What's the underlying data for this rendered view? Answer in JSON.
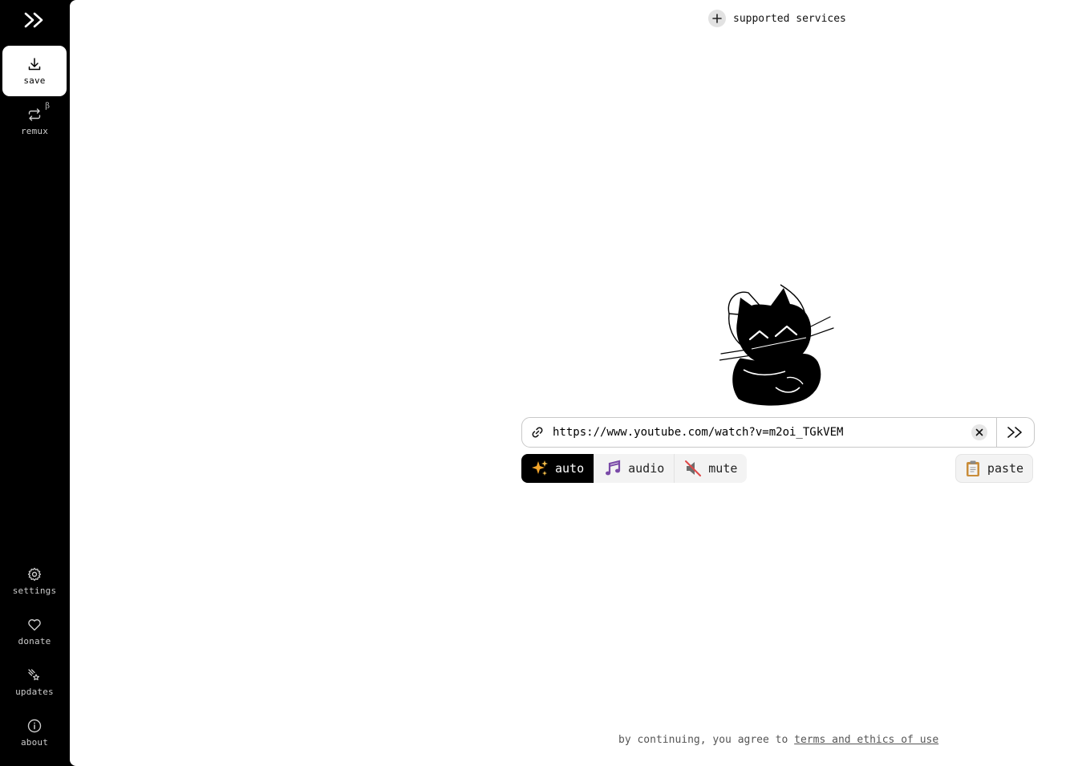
{
  "sidebar": {
    "logo": ">>",
    "items_top": [
      {
        "label": "save",
        "icon": "download-icon",
        "active": true
      },
      {
        "label": "remux",
        "icon": "repeat-icon",
        "badge": "β"
      }
    ],
    "items_bottom": [
      {
        "label": "settings",
        "icon": "gear-icon"
      },
      {
        "label": "donate",
        "icon": "heart-icon"
      },
      {
        "label": "updates",
        "icon": "comet-icon"
      },
      {
        "label": "about",
        "icon": "info-icon"
      }
    ]
  },
  "main": {
    "supported_services": "supported services",
    "url_input": {
      "value": "https://www.youtube.com/watch?v=m2oi_TGkVEM"
    },
    "go_label": ">>",
    "modes": [
      {
        "label": "auto",
        "icon": "sparkles-icon",
        "active": true
      },
      {
        "label": "audio",
        "icon": "music-notes-icon"
      },
      {
        "label": "mute",
        "icon": "muted-speaker-icon"
      }
    ],
    "paste_label": "paste",
    "footer": {
      "prefix": "by continuing, you agree to",
      "link": "terms and ethics of use"
    }
  },
  "colors": {
    "sidebar_bg": "#000000",
    "main_bg": "#ffffff",
    "active_mode_bg": "#000000"
  }
}
